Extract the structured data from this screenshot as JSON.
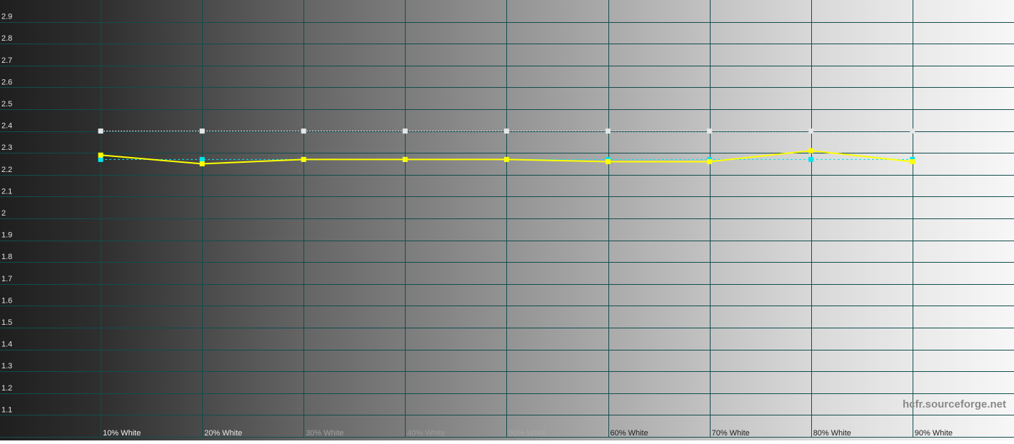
{
  "chart_data": {
    "type": "line",
    "title": "",
    "xlabel": "",
    "ylabel": "",
    "categories": [
      "10% White",
      "20% White",
      "30% White",
      "40% White",
      "50% White",
      "60% White",
      "70% White",
      "80% White",
      "90% White"
    ],
    "y_ticks": [
      "2.9",
      "2.8",
      "2.7",
      "2.6",
      "2.5",
      "2.4",
      "2.3",
      "2.2",
      "2.1",
      "2",
      "1.9",
      "1.8",
      "1.7",
      "1.6",
      "1.5",
      "1.4",
      "1.3",
      "1.2",
      "1.1"
    ],
    "ylim": [
      1.0,
      3.0
    ],
    "grid": true,
    "background": "grayscale ramp from black to white",
    "series": [
      {
        "key": "target",
        "color": "#e6e6e6",
        "style": "dotted",
        "marker": "square",
        "values": [
          2.4,
          2.4,
          2.4,
          2.4,
          2.4,
          2.4,
          2.4,
          2.4,
          2.4
        ]
      },
      {
        "key": "average",
        "color": "#00e5ee",
        "style": "dashed",
        "marker": "square",
        "values": [
          2.27,
          2.27,
          2.27,
          2.27,
          2.27,
          2.27,
          2.27,
          2.27,
          2.27
        ]
      },
      {
        "key": "measured",
        "color": "#ffff00",
        "style": "solid",
        "marker": "square",
        "values": [
          2.29,
          2.25,
          2.27,
          2.27,
          2.27,
          2.26,
          2.26,
          2.31,
          2.26
        ]
      }
    ],
    "watermark": "hcfr.sourceforge.net",
    "grid_color": "#134c4c"
  }
}
